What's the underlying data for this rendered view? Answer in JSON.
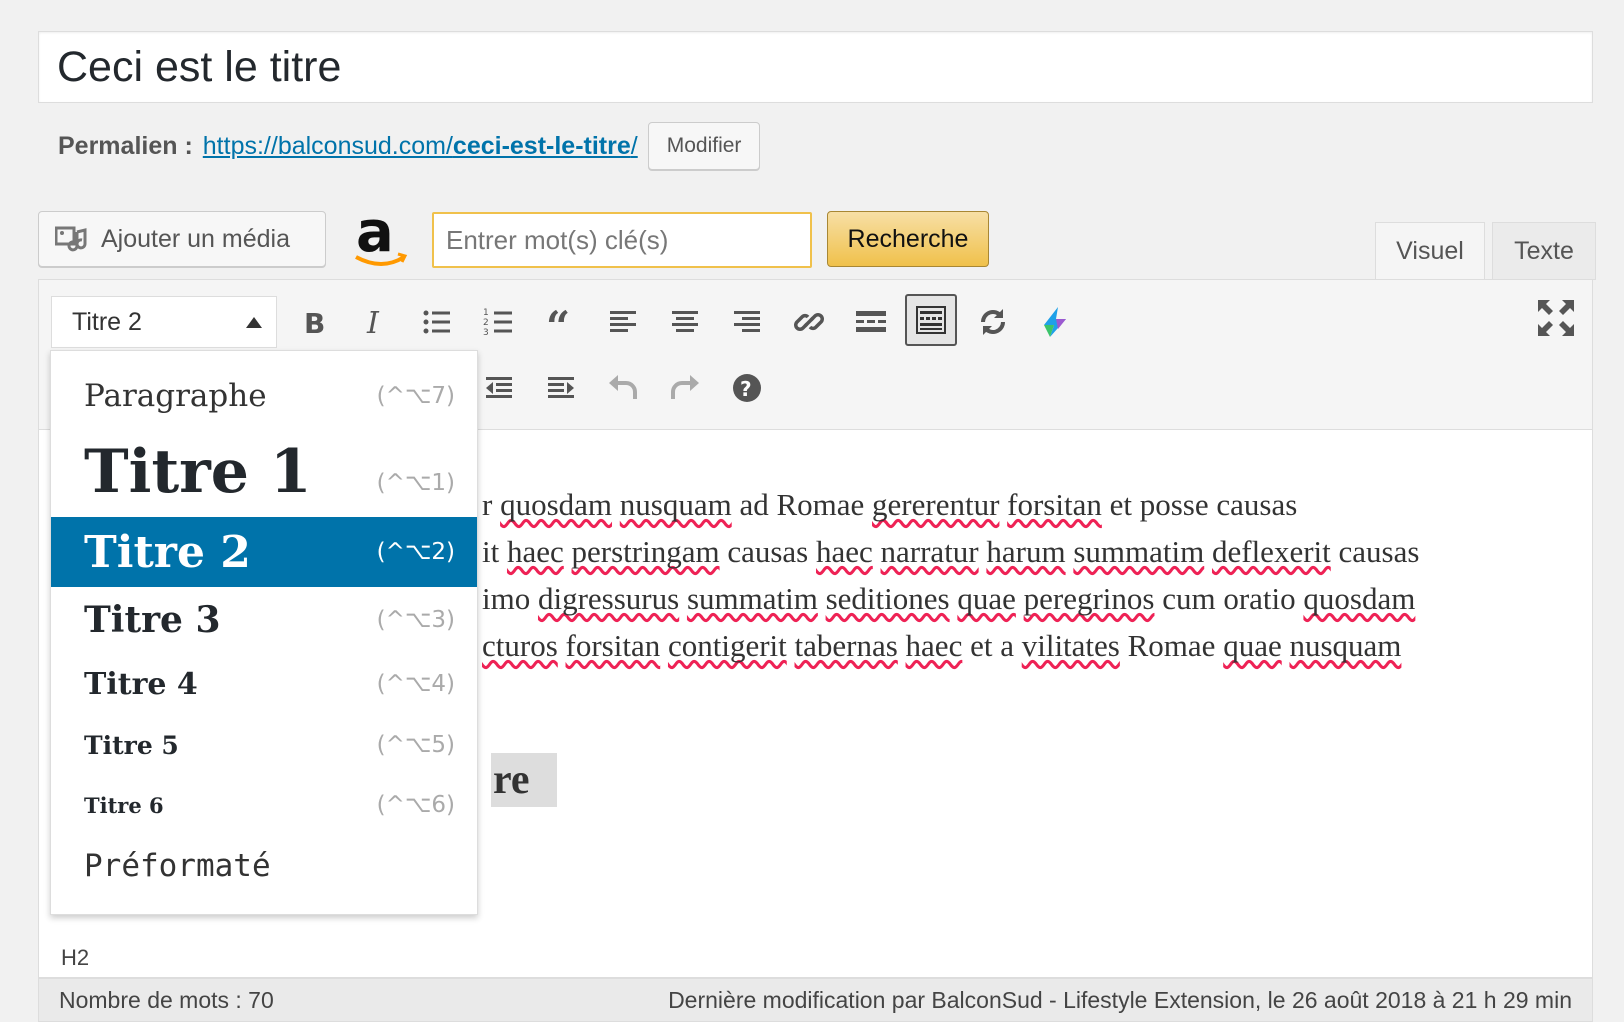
{
  "post": {
    "title": "Ceci est le titre"
  },
  "permalink": {
    "label": "Permalien :",
    "url_prefix": "https://balconsud.com/",
    "url_slug": "ceci-est-le-titre",
    "url_suffix": "/",
    "edit_label": "Modifier"
  },
  "media": {
    "add_media_label": "Ajouter un média",
    "amazon_search_placeholder": "Entrer mot(s) clé(s)",
    "amazon_search_button": "Recherche"
  },
  "tabs": {
    "visual": "Visuel",
    "text": "Texte"
  },
  "toolbar": {
    "format_selected": "Titre 2"
  },
  "format_menu": {
    "items": [
      {
        "label": "Paragraphe",
        "shortcut": "(^⌥7)"
      },
      {
        "label": "Titre 1",
        "shortcut": "(^⌥1)"
      },
      {
        "label": "Titre 2",
        "shortcut": "(^⌥2)"
      },
      {
        "label": "Titre 3",
        "shortcut": "(^⌥3)"
      },
      {
        "label": "Titre 4",
        "shortcut": "(^⌥4)"
      },
      {
        "label": "Titre 5",
        "shortcut": "(^⌥5)"
      },
      {
        "label": "Titre 6",
        "shortcut": "(^⌥6)"
      },
      {
        "label": "Préformaté",
        "shortcut": ""
      }
    ],
    "selected_index": 2
  },
  "content": {
    "lines": [
      [
        "r ",
        "quosdam",
        " ",
        "nusquam",
        " ad Romae ",
        "gererentur",
        " ",
        "forsitan",
        " et posse causas"
      ],
      [
        "it ",
        "haec",
        " ",
        "perstringam",
        " causas ",
        "haec",
        " ",
        "narratur",
        " ",
        "harum",
        " ",
        "summatim",
        " ",
        "deflexerit",
        " causas"
      ],
      [
        "imo ",
        "digressurus",
        " ",
        "summatim",
        " ",
        "seditiones",
        " ",
        "quae",
        " ",
        "peregrinos",
        " cum oratio ",
        "quosdam"
      ],
      [
        "cturos",
        " ",
        "forsitan",
        " ",
        "contigerit",
        " ",
        "tabernas",
        " ",
        "haec",
        " et a ",
        "vilitates",
        " Romae ",
        "quae",
        " ",
        "nusquam"
      ]
    ],
    "heading_fragment": "re"
  },
  "status": {
    "path": "H2",
    "word_count": "Nombre de mots : 70",
    "last_modified": "Dernière modification par BalconSud - Lifestyle Extension, le 26 août 2018 à 21 h 29 min"
  }
}
